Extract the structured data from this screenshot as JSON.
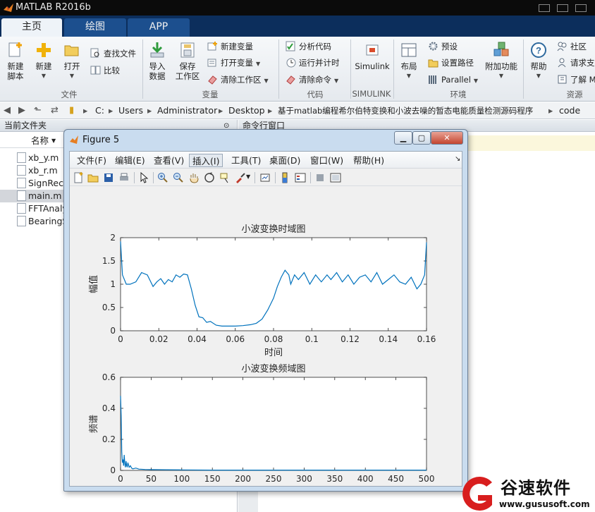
{
  "app": {
    "title": "MATLAB R2016b"
  },
  "tabs": [
    {
      "label": "主页"
    },
    {
      "label": "绘图"
    },
    {
      "label": "APP"
    }
  ],
  "ribbon": {
    "new_script": "新建\n脚本",
    "new": "新建",
    "open": "打开",
    "find_files": "查找文件",
    "compare": "比较",
    "file_section": "文件",
    "import_data": "导入\n数据",
    "save_workspace": "保存\n工作区",
    "new_variable": "新建变量",
    "open_variable": "打开变量",
    "clear_workspace": "清除工作区",
    "variable_section": "变量",
    "analyze_code": "分析代码",
    "run_and_time": "运行并计时",
    "clear_commands": "清除命令",
    "code_section": "代码",
    "simulink": "Simulink",
    "simulink_section": "SIMULINK",
    "layout": "布局",
    "preferences": "预设",
    "set_path": "设置路径",
    "parallel": "Parallel",
    "environment_section": "环境",
    "addons": "附加功能",
    "help": "帮助",
    "community": "社区",
    "request_support": "请求支",
    "learn_matlab": "了解 M",
    "resources_section": "资源"
  },
  "address": {
    "crumbs": [
      "C:",
      "Users",
      "Administrator",
      "Desktop",
      "基于matlab编程希尔伯特变换和小波去噪的暂态电能质量检测源码程序",
      "code"
    ]
  },
  "current_folder": {
    "title": "当前文件夹",
    "name_column": "名称",
    "files": [
      "xb_y.m",
      "xb_r.m",
      "SignRecog",
      "main.m",
      "FFTAnaly",
      "BearingS"
    ]
  },
  "command_window": {
    "title": "命令行窗口"
  },
  "figure": {
    "title": "Figure 5",
    "menus": [
      "文件(F)",
      "编辑(E)",
      "查看(V)",
      "插入(I)",
      "工具(T)",
      "桌面(D)",
      "窗口(W)",
      "帮助(H)"
    ]
  },
  "chart_data": [
    {
      "type": "line",
      "title": "小波变换时域图",
      "xlabel": "时间",
      "ylabel": "幅值",
      "xlim": [
        0,
        0.16
      ],
      "ylim": [
        0,
        2
      ],
      "xticks": [
        "0",
        "0.02",
        "0.04",
        "0.06",
        "0.08",
        "0.1",
        "0.12",
        "0.14",
        "0.16"
      ],
      "yticks": [
        "0",
        "0.5",
        "1",
        "1.5",
        "2"
      ],
      "color": "#0072BD",
      "x": [
        0,
        0.001,
        0.003,
        0.005,
        0.008,
        0.011,
        0.014,
        0.017,
        0.019,
        0.021,
        0.023,
        0.025,
        0.027,
        0.029,
        0.031,
        0.033,
        0.035,
        0.037,
        0.039,
        0.041,
        0.043,
        0.045,
        0.047,
        0.05,
        0.053,
        0.056,
        0.06,
        0.064,
        0.068,
        0.071,
        0.074,
        0.077,
        0.08,
        0.082,
        0.084,
        0.086,
        0.088,
        0.089,
        0.091,
        0.093,
        0.096,
        0.099,
        0.102,
        0.105,
        0.108,
        0.11,
        0.113,
        0.116,
        0.119,
        0.122,
        0.125,
        0.128,
        0.131,
        0.134,
        0.137,
        0.14,
        0.143,
        0.146,
        0.149,
        0.152,
        0.155,
        0.157,
        0.159,
        0.16
      ],
      "y": [
        1.92,
        1.2,
        1.0,
        1.0,
        1.05,
        1.25,
        1.2,
        0.95,
        1.05,
        1.12,
        1.0,
        1.1,
        1.05,
        1.2,
        1.15,
        1.22,
        1.2,
        0.9,
        0.55,
        0.3,
        0.28,
        0.18,
        0.2,
        0.12,
        0.1,
        0.1,
        0.1,
        0.11,
        0.13,
        0.16,
        0.25,
        0.45,
        0.7,
        0.95,
        1.15,
        1.3,
        1.2,
        1.0,
        1.2,
        1.1,
        1.25,
        1.0,
        1.2,
        1.05,
        1.2,
        1.1,
        1.25,
        1.05,
        1.2,
        1.0,
        1.15,
        1.2,
        1.05,
        1.25,
        1.0,
        1.1,
        1.2,
        1.05,
        1.0,
        1.15,
        0.9,
        1.0,
        1.2,
        1.9
      ]
    },
    {
      "type": "line",
      "title": "小波变换频域图",
      "xlabel": "频率",
      "ylabel": "频谱",
      "xlim": [
        0,
        500
      ],
      "ylim": [
        0,
        0.6
      ],
      "xticks": [
        "0",
        "50",
        "100",
        "150",
        "200",
        "250",
        "300",
        "350",
        "400",
        "450",
        "500"
      ],
      "yticks": [
        "0",
        "0.2",
        "0.4",
        "0.6"
      ],
      "color": "#0072BD",
      "x": [
        0,
        1,
        2,
        3,
        4,
        5,
        6,
        7,
        8,
        9,
        10,
        11,
        12,
        14,
        16,
        18,
        20,
        25,
        30,
        40,
        50,
        75,
        100,
        150,
        200,
        250,
        300,
        350,
        400,
        450,
        500
      ],
      "y": [
        0.48,
        0.35,
        0.12,
        0.05,
        0.07,
        0.03,
        0.1,
        0.04,
        0.02,
        0.06,
        0.03,
        0.02,
        0.05,
        0.02,
        0.03,
        0.015,
        0.01,
        0.015,
        0.008,
        0.006,
        0.005,
        0.004,
        0.003,
        0.002,
        0.002,
        0.002,
        0.002,
        0.002,
        0.002,
        0.002,
        0.002
      ]
    }
  ],
  "watermark": {
    "name": "谷速软件",
    "url": "www.gususoft.com"
  }
}
